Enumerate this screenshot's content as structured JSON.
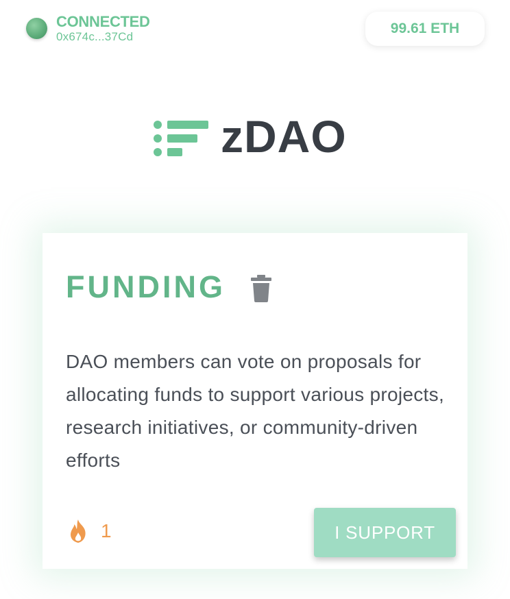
{
  "header": {
    "status_label": "CONNECTED",
    "wallet_address": "0x674c...37Cd",
    "balance": "99.61 ETH"
  },
  "logo": {
    "text": "zDAO",
    "icon": "list-lines-icon"
  },
  "card": {
    "title": "FUNDING",
    "delete_icon": "trash-icon",
    "description": "DAO members can vote on proposals for allocating funds to support various projects, research initiatives, or community-driven efforts",
    "support_icon": "fire-icon",
    "support_count": "1",
    "support_button_label": "I SUPPORT"
  },
  "colors": {
    "accent_green": "#6cc596",
    "title_green": "#62b589",
    "button_green": "#9fdcc3",
    "count_orange": "#ef9a4d",
    "text_dark": "#383d44"
  }
}
